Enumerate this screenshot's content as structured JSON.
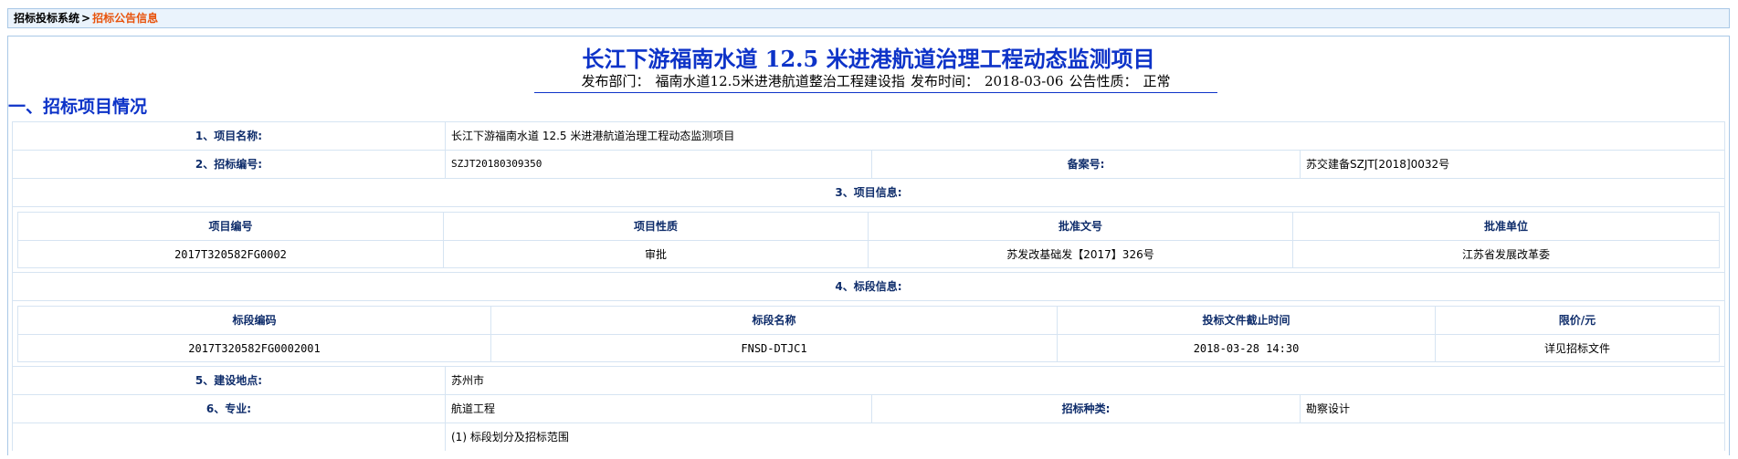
{
  "breadcrumb": {
    "root": "招标投标系统",
    "separator": ">",
    "current": "招标公告信息"
  },
  "notice": {
    "title": "长江下游福南水道 12.5 米进港航道治理工程动态监测项目",
    "meta": {
      "department_label": "发布部门：",
      "department_value": "福南水道12.5米进港航道整治工程建设指",
      "time_label": "发布时间：",
      "time_value": "2018-03-06",
      "nature_label": "公告性质：",
      "nature_value": "正常"
    },
    "section_heading": "一、招标项目情况"
  },
  "fields": {
    "project_name_label": "1、项目名称:",
    "project_name_value": "长江下游福南水道 12.5 米进港航道治理工程动态监测项目",
    "tender_no_label": "2、招标编号:",
    "tender_no_value": "SZJT20180309350",
    "record_no_label": "备案号:",
    "record_no_value": "苏交建备SZJT[2018]0032号",
    "project_info_label": "3、项目信息:",
    "section_info_label": "4、标段信息:",
    "location_label": "5、建设地点:",
    "location_value": "苏州市",
    "major_label": "6、专业:",
    "major_value": "航道工程",
    "category_label": "招标种类:",
    "category_value": "勘察设计",
    "scope_value": "(1) 标段划分及招标范围"
  },
  "project_info": {
    "headers": [
      "项目编号",
      "项目性质",
      "批准文号",
      "批准单位"
    ],
    "row": [
      "2017T320582FG0002",
      "审批",
      "苏发改基础发【2017】326号",
      "江苏省发展改革委"
    ]
  },
  "section_info": {
    "headers": [
      "标段编码",
      "标段名称",
      "投标文件截止时间",
      "限价/元"
    ],
    "row": [
      "2017T320582FG0002001",
      "FNSD-DTJC1",
      "2018-03-28 14:30",
      "详见招标文件"
    ]
  },
  "colors": {
    "title_blue": "#0d33c8",
    "label_navy": "#0f2d6b",
    "breadcrumb_orange": "#e8530c",
    "border": "#d6e4f2",
    "breadcrumb_bg": "#eaf3fc"
  }
}
